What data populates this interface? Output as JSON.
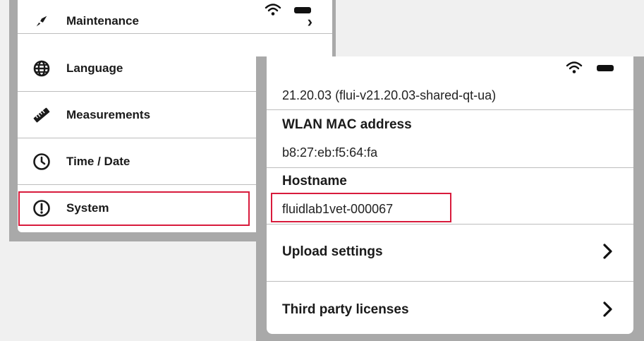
{
  "left_panel": {
    "menu": [
      {
        "label": "Maintenance",
        "icon": "rocket-icon"
      },
      {
        "label": "Language",
        "icon": "globe-icon"
      },
      {
        "label": "Measurements",
        "icon": "ruler-icon"
      },
      {
        "label": "Time / Date",
        "icon": "clock-icon"
      },
      {
        "label": "System",
        "icon": "alert-circle-icon"
      }
    ]
  },
  "right_panel": {
    "version": "21.20.03 (flui-v21.20.03-shared-qt-ua)",
    "wlan_mac_label": "WLAN MAC address",
    "wlan_mac_value": "b8:27:eb:f5:64:fa",
    "hostname_label": "Hostname",
    "hostname_value": "fluidlab1vet-000067",
    "nav": [
      {
        "label": "Upload settings"
      },
      {
        "label": "Third party licenses"
      }
    ]
  },
  "colors": {
    "highlight": "#d81b3c",
    "backdrop": "#a9a9a9",
    "card": "#ffffff"
  }
}
